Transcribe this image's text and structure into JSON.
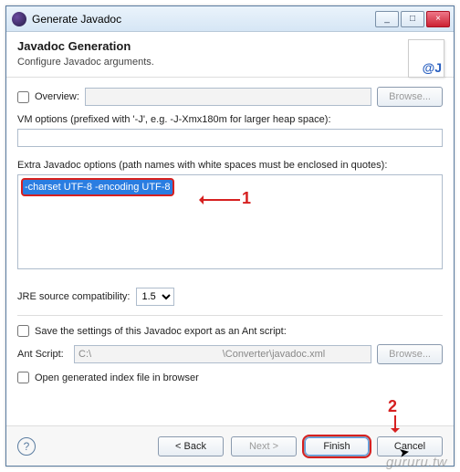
{
  "window": {
    "title": "Generate Javadoc",
    "min": "_",
    "max": "□",
    "close": "×"
  },
  "header": {
    "title": "Javadoc Generation",
    "subtitle": "Configure Javadoc arguments."
  },
  "overview": {
    "label": "Overview:",
    "value": "",
    "browse": "Browse..."
  },
  "vm": {
    "label": "VM options (prefixed with '-J', e.g. -J-Xmx180m for larger heap space):",
    "value": ""
  },
  "extra": {
    "label": "Extra Javadoc options (path names with white spaces must be enclosed in quotes):",
    "value": "-charset UTF-8 -encoding UTF-8"
  },
  "jre": {
    "label": "JRE source compatibility:",
    "value": "1.5"
  },
  "ant": {
    "save_label": "Save the settings of this Javadoc export as an Ant script:",
    "label": "Ant Script:",
    "value": "C:\\                                               \\Converter\\javadoc.xml",
    "browse": "Browse..."
  },
  "open_index": {
    "label": "Open generated index file in browser"
  },
  "footer": {
    "back": "< Back",
    "next": "Next >",
    "finish": "Finish",
    "cancel": "Cancel",
    "help": "?"
  },
  "annotations": {
    "one": "1",
    "two": "2"
  },
  "watermark": "gururu.tw"
}
